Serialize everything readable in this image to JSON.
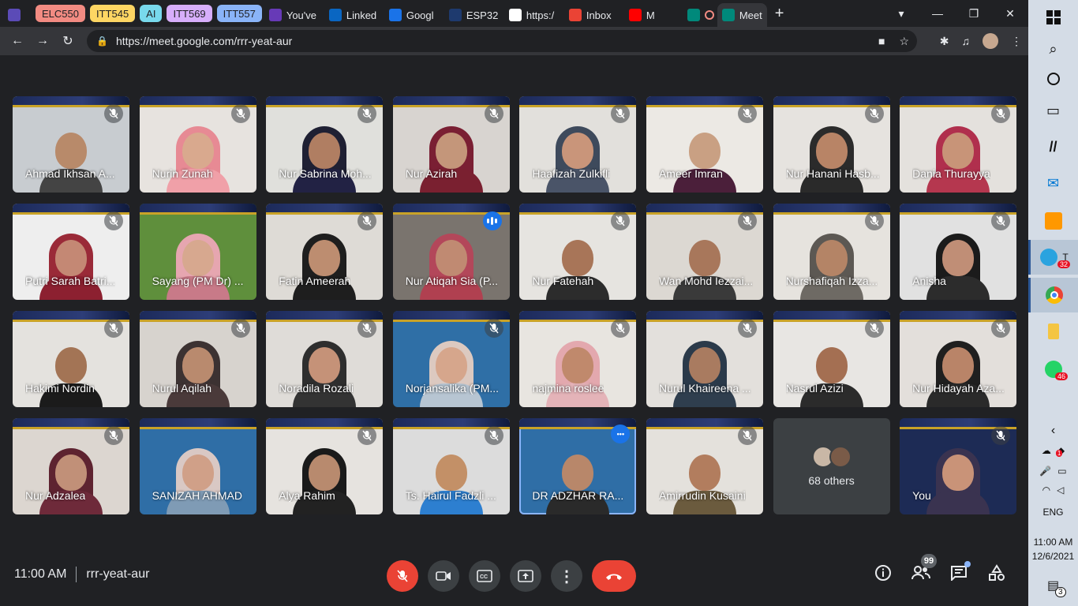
{
  "browser": {
    "tab_groups": [
      {
        "label": "ELC550",
        "color": "#f28b82"
      },
      {
        "label": "ITT545",
        "color": "#fdd663"
      },
      {
        "label": "AI",
        "color": "#78d9ec"
      },
      {
        "label": "ITT569",
        "color": "#d7aefb"
      },
      {
        "label": "ITT557",
        "color": "#8ab4f8"
      }
    ],
    "tabs": [
      {
        "label": "You've",
        "icon": "forms-icon",
        "color": "#673ab7"
      },
      {
        "label": "Linked",
        "icon": "linkedin-icon",
        "color": "#0a66c2"
      },
      {
        "label": "Googl",
        "icon": "google-7-icon",
        "color": "#1a73e8"
      },
      {
        "label": "ESP32",
        "icon": "r-icon",
        "color": "#1e3a6e"
      },
      {
        "label": "https:/",
        "icon": "pen-icon",
        "color": "#ffffff"
      },
      {
        "label": "Inbox",
        "icon": "gmail-icon",
        "color": "#ea4335"
      },
      {
        "label": "M",
        "icon": "youtube-icon",
        "color": "#ff0000"
      }
    ],
    "active_tab": {
      "label": "Meet"
    },
    "url": "https://meet.google.com/rrr-yeat-aur"
  },
  "meet": {
    "participants": [
      {
        "name": "Ahmad Ikhsan A...",
        "muted": true,
        "bg": "#c8ccd0",
        "skin": "#b88a6a",
        "wear": "#444444",
        "hijab": ""
      },
      {
        "name": "Nurin Zunah",
        "muted": true,
        "bg": "#e7e3df",
        "skin": "#d9a98e",
        "wear": "#f0a0a8",
        "hijab": "#e78a94"
      },
      {
        "name": "Nur Sabrina Moh...",
        "muted": true,
        "bg": "#e0e0dc",
        "skin": "#b07e62",
        "wear": "#222244",
        "hijab": "#1f2033"
      },
      {
        "name": "Nur Azirah",
        "muted": true,
        "bg": "#d8d4d0",
        "skin": "#c4967a",
        "wear": "#7a2030",
        "hijab": "#7a1f33"
      },
      {
        "name": "Haafizah Zulkifli",
        "muted": true,
        "bg": "#e2e0dc",
        "skin": "#c9957a",
        "wear": "#4a5468",
        "hijab": "#3e4a5c"
      },
      {
        "name": "Ameer Imran",
        "muted": true,
        "bg": "#ece9e4",
        "skin": "#c9a083",
        "wear": "#4b1f3a",
        "hijab": ""
      },
      {
        "name": "Nur Hanani Hasb...",
        "muted": true,
        "bg": "#e6e3df",
        "skin": "#b88466",
        "wear": "#2a2a2a",
        "hijab": "#2b2b2b"
      },
      {
        "name": "Dania Thurayya",
        "muted": true,
        "bg": "#e4e1dd",
        "skin": "#c89478",
        "wear": "#b5374f",
        "hijab": "#b02f4d"
      },
      {
        "name": "Putri Sarah Batri...",
        "muted": true,
        "bg": "#eeeeee",
        "skin": "#c48874",
        "wear": "#8c2030",
        "hijab": "#9a2a38"
      },
      {
        "name": "Sayang (PM Dr) ...",
        "muted": false,
        "bg": "#5f8f3c",
        "skin": "#d7a88f",
        "wear": "#c87a88",
        "hijab": "#e6a6b0"
      },
      {
        "name": "Fatin Ameerah",
        "muted": true,
        "bg": "#dedbd6",
        "skin": "#bd8d70",
        "wear": "#1e1e1e",
        "hijab": "#1e1e1e"
      },
      {
        "name": "Nur Atiqah Sia (P...",
        "muted": false,
        "speaking": true,
        "bg": "#7a746e",
        "skin": "#c08a72",
        "wear": "#b04050",
        "hijab": "#b3475a"
      },
      {
        "name": "Nur Fatehah",
        "muted": true,
        "bg": "#e6e4e0",
        "skin": "#a87558",
        "wear": "#2c2c2c",
        "hijab": ""
      },
      {
        "name": "Wan Mohd Iezzai...",
        "muted": true,
        "bg": "#dcd8d2",
        "skin": "#a8775b",
        "wear": "#3a3a3a",
        "hijab": ""
      },
      {
        "name": "Nurshafiqah Izza...",
        "muted": true,
        "bg": "#e6e3de",
        "skin": "#b48466",
        "wear": "#6e6a64",
        "hijab": "#5c5853"
      },
      {
        "name": "Anisha",
        "muted": true,
        "bg": "#e1e1e1",
        "skin": "#c08e76",
        "wear": "#2c2c2c",
        "hijab": "#1b1b1b"
      },
      {
        "name": "Hakimi Nordin",
        "muted": true,
        "bg": "#e4e2de",
        "skin": "#a37455",
        "wear": "#1b1b1b",
        "hijab": ""
      },
      {
        "name": "Nurul Aqilah",
        "muted": true,
        "bg": "#d7d3ce",
        "skin": "#b98a6e",
        "wear": "#4a3a3a",
        "hijab": "#3c3232"
      },
      {
        "name": "Noradila Rozali",
        "muted": true,
        "bg": "#dfdcd8",
        "skin": "#c59278",
        "wear": "#333333",
        "hijab": "#2e2e2e"
      },
      {
        "name": "Norjansalika (PM...",
        "muted": true,
        "bg": "#2f6fa6",
        "skin": "#d6a68c",
        "wear": "#b7c5d2",
        "hijab": "#dcc9c0"
      },
      {
        "name": "najmina roslee",
        "muted": true,
        "bg": "#e8e5e0",
        "skin": "#c0896c",
        "wear": "#e4b3b8",
        "hijab": "#e3a8ae"
      },
      {
        "name": "Nurul Khaireena ...",
        "muted": true,
        "bg": "#e3e0dc",
        "skin": "#a97b60",
        "wear": "#2f3e4e",
        "hijab": "#2b3a4a"
      },
      {
        "name": "Nasrul Azizi",
        "muted": true,
        "bg": "#e8e6e3",
        "skin": "#a46f52",
        "wear": "#2b2b2b",
        "hijab": ""
      },
      {
        "name": "Nur Hidayah Aza...",
        "muted": true,
        "bg": "#e3dfdb",
        "skin": "#b98468",
        "wear": "#2a2a2a",
        "hijab": "#1f1f1f"
      },
      {
        "name": "Nur Adzalea",
        "muted": true,
        "bg": "#dcd6d0",
        "skin": "#c19078",
        "wear": "#6e2a3a",
        "hijab": "#5e2330"
      },
      {
        "name": "SANIZAH AHMAD",
        "muted": false,
        "bg": "#2f6ea6",
        "skin": "#d0a088",
        "wear": "#7f9bb5",
        "hijab": "#d9c8c4"
      },
      {
        "name": "Alya Rahim",
        "muted": true,
        "bg": "#e6e3df",
        "skin": "#b88a6e",
        "wear": "#222222",
        "hijab": "#1a1a1a"
      },
      {
        "name": "Ts. Hairul Fadzli ...",
        "muted": true,
        "bg": "#dcdcdc",
        "skin": "#c39067",
        "wear": "#2d7fd0",
        "hijab": ""
      },
      {
        "name": "DR ADZHAR RA...",
        "muted": false,
        "pinned": true,
        "more": true,
        "bg": "#2f6ea6",
        "skin": "#b8876a",
        "wear": "#2a2a2a",
        "hijab": ""
      },
      {
        "name": "Amirrudin Kusaini",
        "muted": true,
        "bg": "#e4e1dc",
        "skin": "#b27d5e",
        "wear": "#6b5b3e",
        "hijab": ""
      }
    ],
    "others": {
      "label": "68 others",
      "avatar_colors": [
        "#c9b7a6",
        "#7a5b48"
      ]
    },
    "self": {
      "name": "You",
      "muted": true,
      "bg": "#1d2b55",
      "skin": "#c99378",
      "wear": "#3a3350",
      "hijab": "#3a3350"
    },
    "time": "11:00 AM",
    "meeting_code": "rrr-yeat-aur",
    "people_badge": "99"
  },
  "taskbar": {
    "telegram_label": "T",
    "telegram_badge": "32",
    "whatsapp_badge": "46",
    "language": "ENG",
    "clock_time": "11:00 AM",
    "clock_date": "12/6/2021",
    "notification_count": "3",
    "battery_badge": "1"
  }
}
